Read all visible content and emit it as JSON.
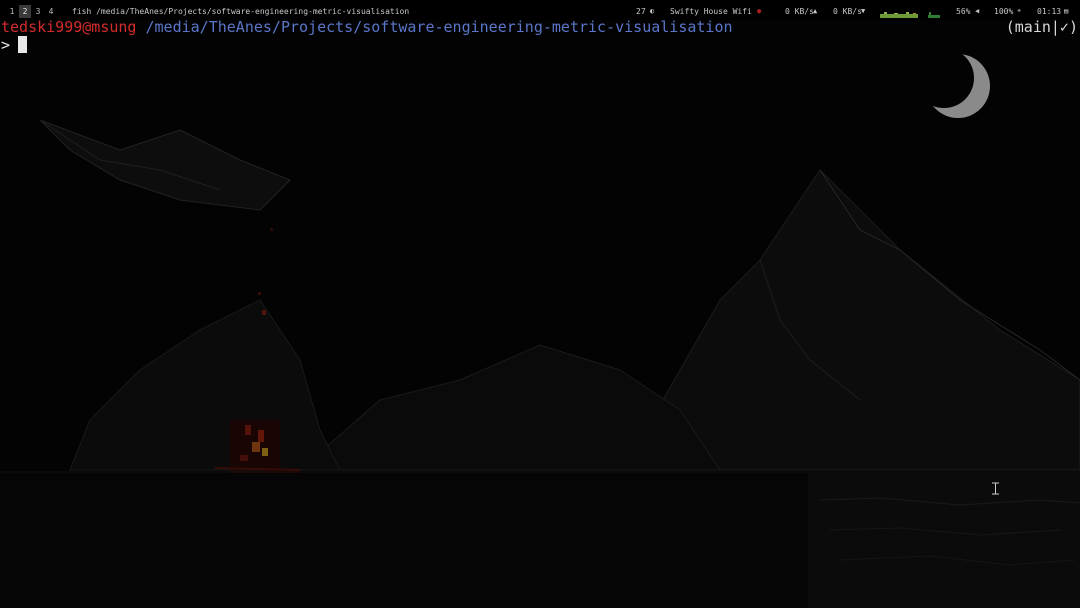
{
  "topbar": {
    "workspaces": [
      "1",
      "2",
      "3",
      "4"
    ],
    "active_workspace": "2",
    "window_title": "fish /media/TheAnes/Projects/software-engineering-metric-visualisation",
    "temperature": "27",
    "wifi_name": "Swifty House Wifi",
    "upload_speed": "0 KB/s",
    "download_speed": "0 KB/s",
    "volume": "56%",
    "brightness": "100%",
    "clock": "01:13",
    "colors": {
      "cpu_graph": "#6f9a3a",
      "net_graph": "#2f7d32",
      "wifi_dot": "#b21e1e"
    }
  },
  "terminal": {
    "user_host": "tedski999@msung",
    "cwd": "/media/TheAnes/Projects/software-engineering-metric-visualisation",
    "prompt_symbol": ">",
    "git_status": "(main|✓)",
    "colors": {
      "user_host": "#d42c2c",
      "cwd": "#5b76c9",
      "text": "#e8e8e8"
    }
  }
}
